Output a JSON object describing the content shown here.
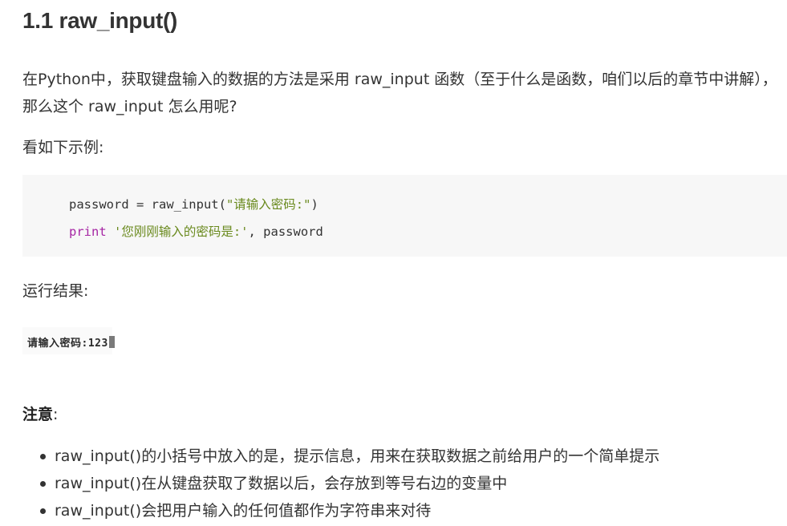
{
  "heading": "1.1 raw_input()",
  "intro_paragraph": "在Python中，获取键盘输入的数据的方法是采用 raw_input 函数（至于什么是函数，咱们以后的章节中讲解），那么这个 raw_input 怎么用呢?",
  "example_label": "看如下示例:",
  "code": {
    "line1_plain": "password = raw_input(",
    "line1_string": "\"请输入密码:\"",
    "line1_end": ")",
    "line2_keyword": "print",
    "line2_string": "'您刚刚输入的密码是:'",
    "line2_end": ", password"
  },
  "result_label": "运行结果:",
  "terminal_output": "请输入密码:123",
  "note_label": "注意",
  "note_colon": ":",
  "notes": [
    "raw_input()的小括号中放入的是，提示信息，用来在获取数据之前给用户的一个简单提示",
    "raw_input()在从键盘获取了数据以后，会存放到等号右边的变量中",
    "raw_input()会把用户输入的任何值都作为字符串来对待"
  ]
}
